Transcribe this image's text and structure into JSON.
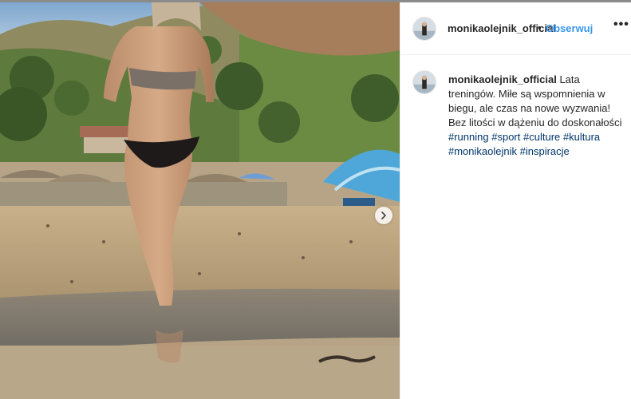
{
  "post": {
    "username": "monikaolejnik_official",
    "separator": "•",
    "follow_label": "Obserwuj",
    "more_label": "•••",
    "next_icon": "chevron-right-icon"
  },
  "caption": {
    "username": "monikaolejnik_official",
    "text_1": " Lata treningów. Miłe są wspomnienia w biegu, ale czas na nowe wyzwania! Bez litości w dążeniu do doskonałości ",
    "hashtags": [
      "#running",
      "#sport",
      "#culture",
      "#kultura",
      "#monikaolejnik",
      "#inspiracje"
    ]
  },
  "colors": {
    "link": "#3897f0",
    "hashtag": "#003569",
    "text": "#262626",
    "border": "#efefef"
  }
}
